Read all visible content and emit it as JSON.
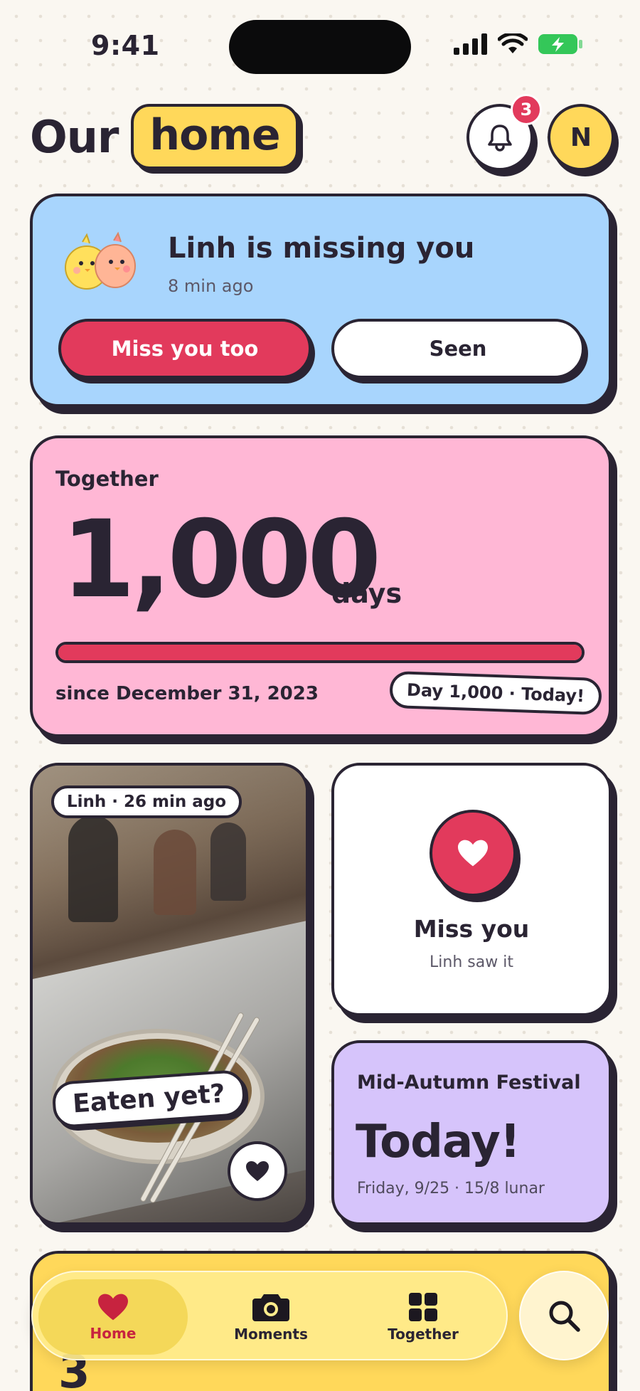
{
  "status_bar": {
    "time": "9:41"
  },
  "header": {
    "brand_prefix": "Our",
    "brand_highlight": "home",
    "notification_count": "3",
    "avatar_initial": "N"
  },
  "missing_card": {
    "title": "Linh is missing you",
    "time_ago": "8 min ago",
    "primary_button": "Miss you too",
    "secondary_button": "Seen"
  },
  "together_card": {
    "label": "Together",
    "count": "1,000",
    "unit": "days",
    "progress_percent": 100,
    "since": "since December 31, 2023",
    "day_chip": "Day 1,000 · Today!"
  },
  "photo_card": {
    "tag": "Linh · 26 min ago",
    "caption": "Eaten yet?"
  },
  "missyou_card": {
    "title": "Miss you",
    "subtitle": "Linh saw it"
  },
  "festival_card": {
    "title": "Mid-Autumn Festival",
    "headline": "Today!",
    "date": "Friday, 9/25 · 15/8 lunar"
  },
  "bottom_card": {
    "peek_text": "3"
  },
  "tabbar": {
    "tabs": [
      {
        "label": "Home",
        "icon": "heart-icon",
        "active": true
      },
      {
        "label": "Moments",
        "icon": "camera-icon",
        "active": false
      },
      {
        "label": "Together",
        "icon": "grid-icon",
        "active": false
      }
    ],
    "search_icon": "search-icon"
  },
  "colors": {
    "ink": "#2a2433",
    "accent_red": "#e23a5c",
    "yellow": "#ffd85a",
    "blue_card": "#a8d5fd",
    "pink_card": "#ffb7d5",
    "purple_card": "#d6c4fb",
    "background": "#faf7f1"
  }
}
